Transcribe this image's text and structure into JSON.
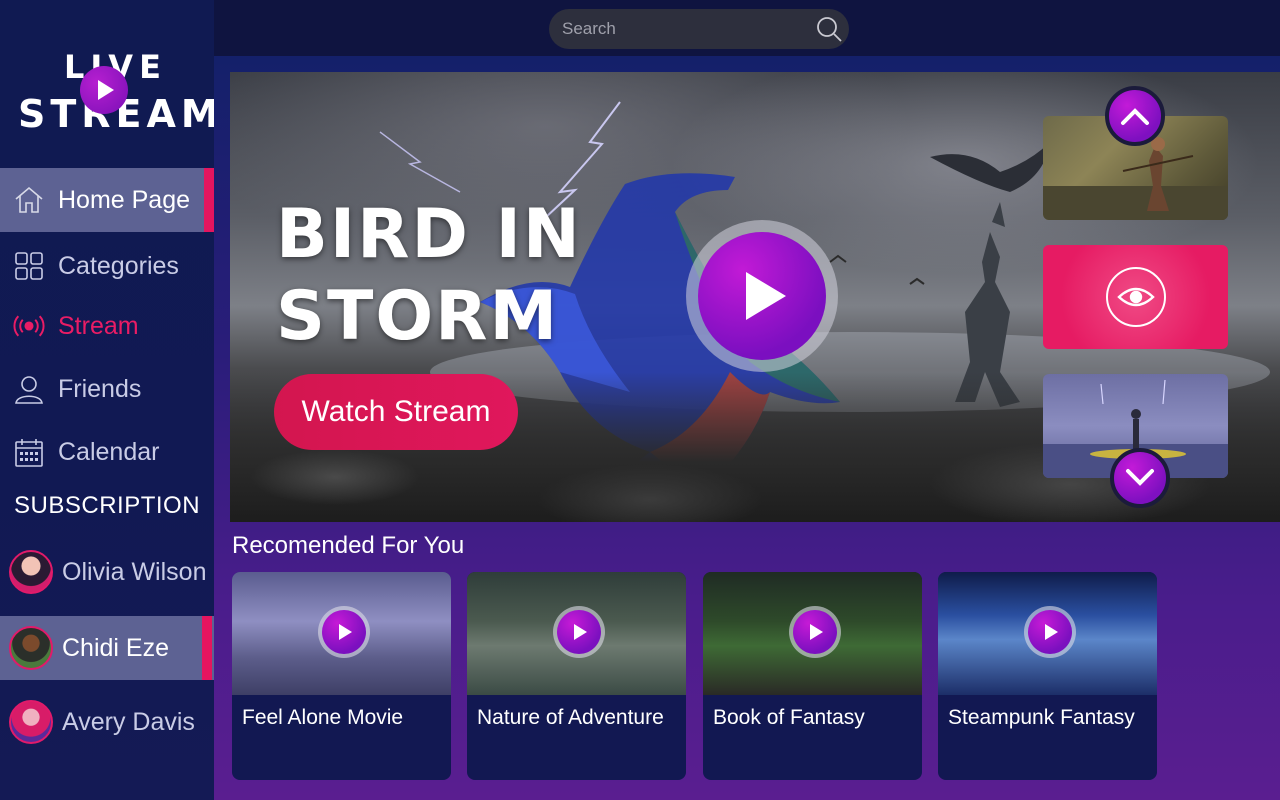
{
  "logo": {
    "line1": "LIVE",
    "line2": "STREAM"
  },
  "nav": {
    "items": [
      {
        "label": "Home Page",
        "icon": "home-icon"
      },
      {
        "label": "Categories",
        "icon": "grid-icon"
      },
      {
        "label": "Stream",
        "icon": "broadcast-icon"
      },
      {
        "label": "Friends",
        "icon": "user-icon"
      },
      {
        "label": "Calendar",
        "icon": "calendar-icon"
      }
    ],
    "active": "Home Page"
  },
  "subscription": {
    "title": "SUBSCRIPTION",
    "items": [
      {
        "name": "Olivia Wilson"
      },
      {
        "name": "Chidi Eze"
      },
      {
        "name": "Avery Davis"
      }
    ],
    "active": "Chidi Eze"
  },
  "search": {
    "placeholder": "Search"
  },
  "hero": {
    "title": "BIRD IN STORM",
    "watch_label": "Watch Stream"
  },
  "recommended": {
    "title": "Recomended For You",
    "items": [
      {
        "label": "Feel Alone Movie"
      },
      {
        "label": "Nature of Adventure"
      },
      {
        "label": "Book of Fantasy"
      },
      {
        "label": "Steampunk Fantasy"
      }
    ]
  },
  "colors": {
    "accent": "#e4155f",
    "play_purple": "#9a16cc",
    "sidebar_bg": "#101a52",
    "active_item_bg": "#5d6293"
  }
}
